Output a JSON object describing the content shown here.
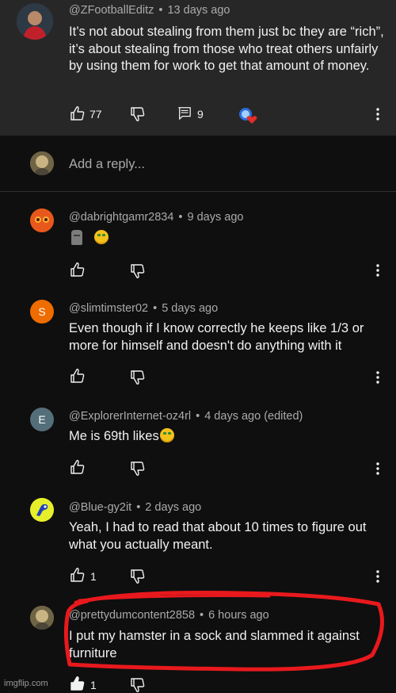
{
  "colors": {
    "background": "#0f0f0f",
    "parent_background": "#272727",
    "text": "#f1f1f1",
    "meta_text": "#aaaaaa",
    "highlight": "#e8191d"
  },
  "parent_comment": {
    "author": "@ZFootballEditz",
    "time": "13 days ago",
    "text": "It’s not about stealing from them just bc they are “rich”, it’s about stealing from those who treat others unfairly by using them for work to get that amount of money.",
    "likes": "77",
    "replies": "9",
    "icons": [
      "like-icon",
      "dislike-icon",
      "replies-icon",
      "creator-heart-icon",
      "more-icon"
    ]
  },
  "reply_box": {
    "placeholder": "Add a reply..."
  },
  "replies": [
    {
      "author": "@dabrightgamr2834",
      "time": "9 days ago",
      "text": "",
      "emojis": [
        "moai",
        "money-mouth-face"
      ],
      "likes": ""
    },
    {
      "author": "@slimtimster02",
      "time": "5 days ago",
      "text": "Even though if I know correctly he keeps like 1/3 or more for himself and doesn't do anything with it",
      "avatar_letter": "S",
      "avatar_color": "#ef6c00",
      "likes": ""
    },
    {
      "author": "@ExplorerInternet-oz4rl",
      "time": "4 days ago (edited)",
      "text": "Me is 69th likes",
      "avatar_letter": "E",
      "avatar_color": "#546e7a",
      "likes": ""
    },
    {
      "author": "@Blue-gy2it",
      "time": "2 days ago",
      "text": "Yeah, I had to read that about 10 times to figure out what you actually meant.",
      "likes": "1"
    },
    {
      "author": "@prettydumcontent2858",
      "time": "6 hours ago",
      "text": "I put my hamster in a sock and slammed it against furniture",
      "likes": "1"
    }
  ],
  "watermark": "imgflip.com"
}
